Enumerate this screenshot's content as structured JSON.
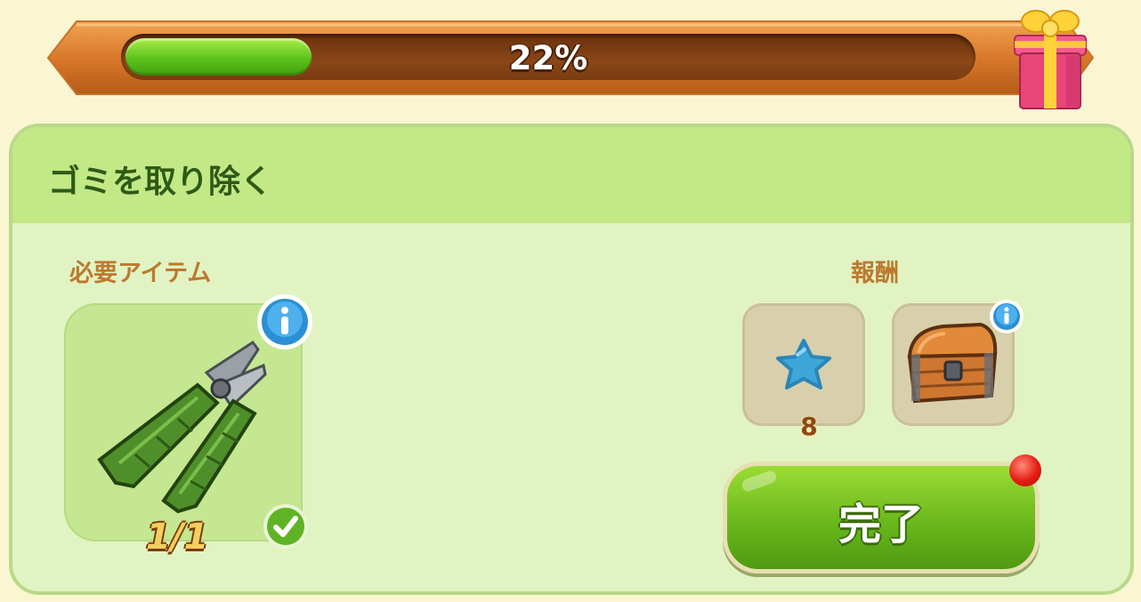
{
  "progress": {
    "value": 0.22,
    "label": "22%",
    "bar_color": "#5cc21a",
    "reward_icon": "gift-box-icon"
  },
  "task": {
    "title": "ゴミを取り除く",
    "required_label": "必要アイテム",
    "required_item": {
      "icon": "pruning-shears-icon",
      "count": "1/1",
      "status_icon": "check-icon",
      "info_icon": "info-icon"
    },
    "rewards_label": "報酬",
    "rewards": [
      {
        "icon": "blue-star-icon",
        "quantity": "8"
      },
      {
        "icon": "treasure-chest-icon",
        "info_icon": "info-icon"
      }
    ],
    "complete_button": "完了"
  },
  "colors": {
    "background": "#fbf6d2",
    "card": "#e2f3c3",
    "card_header": "#c3e886",
    "accent_text": "#bb7a2f",
    "title_text": "#2e5a16"
  }
}
